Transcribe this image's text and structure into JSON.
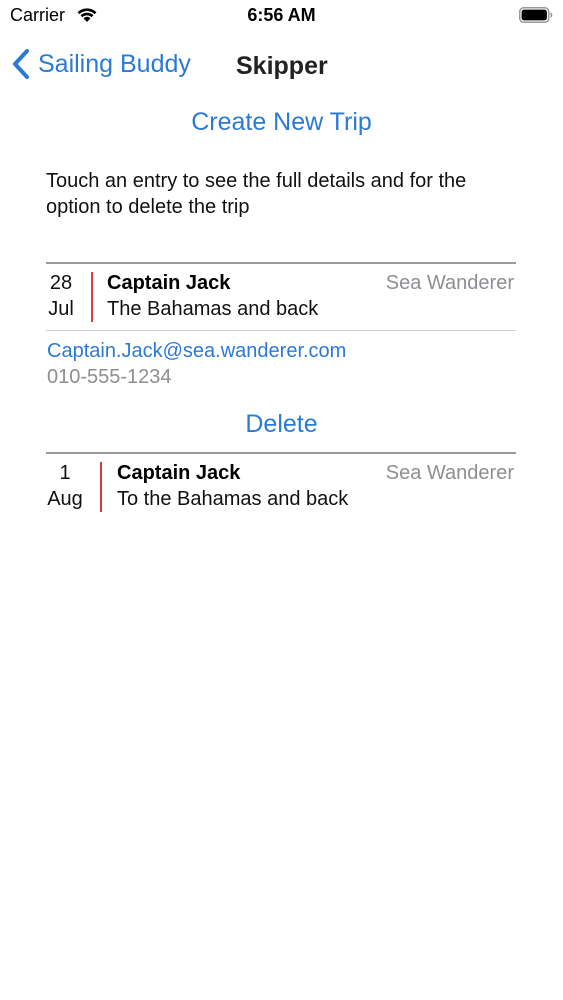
{
  "status_bar": {
    "carrier": "Carrier",
    "time": "6:56 AM",
    "icons": [
      "wifi-icon",
      "battery-icon"
    ]
  },
  "nav": {
    "back_label": "Sailing Buddy",
    "title": "Skipper"
  },
  "create_trip_label": "Create New Trip",
  "instructions": "Touch an entry to see the full details and for the option to delete the trip",
  "trips": [
    {
      "day": "28",
      "month": "Jul",
      "skipper": "Captain Jack",
      "description": "The Bahamas and back",
      "boat": "Sea Wanderer",
      "expanded": true,
      "email": "Captain.Jack@sea.wanderer.com",
      "phone": "010-555-1234",
      "delete_label": "Delete"
    },
    {
      "day": "1",
      "month": "Aug",
      "skipper": "Captain Jack",
      "description": "To the Bahamas and back",
      "boat": "Sea Wanderer",
      "expanded": false
    }
  ],
  "colors": {
    "accent": "#2a7ad6",
    "date_bar": "#e03a3a",
    "secondary_text": "#8e8e93"
  }
}
